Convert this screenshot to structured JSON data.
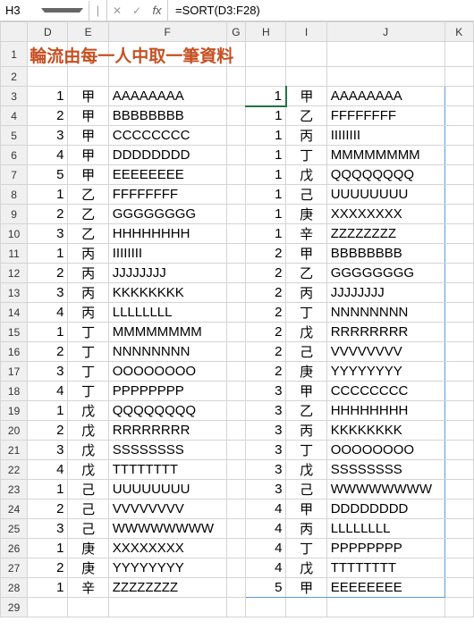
{
  "formula_bar": {
    "name_box": "H3",
    "cancel": "✕",
    "check": "✓",
    "fx": "fx",
    "formula": "=SORT(D3:F28)"
  },
  "columns": [
    "",
    "D",
    "E",
    "F",
    "G",
    "H",
    "I",
    "J",
    "K"
  ],
  "title": "輪流由每一人中取一筆資料",
  "chart_data": {
    "type": "table",
    "left_table": {
      "columns": [
        "D",
        "E",
        "F"
      ],
      "rows": [
        [
          1,
          "甲",
          "AAAAAAAA"
        ],
        [
          2,
          "甲",
          "BBBBBBBB"
        ],
        [
          3,
          "甲",
          "CCCCCCCC"
        ],
        [
          4,
          "甲",
          "DDDDDDDD"
        ],
        [
          5,
          "甲",
          "EEEEEEEE"
        ],
        [
          1,
          "乙",
          "FFFFFFFF"
        ],
        [
          2,
          "乙",
          "GGGGGGGG"
        ],
        [
          3,
          "乙",
          "HHHHHHHH"
        ],
        [
          1,
          "丙",
          "IIIIIIII"
        ],
        [
          2,
          "丙",
          "JJJJJJJJ"
        ],
        [
          3,
          "丙",
          "KKKKKKKK"
        ],
        [
          4,
          "丙",
          "LLLLLLLL"
        ],
        [
          1,
          "丁",
          "MMMMMMMM"
        ],
        [
          2,
          "丁",
          "NNNNNNNN"
        ],
        [
          3,
          "丁",
          "OOOOOOOO"
        ],
        [
          4,
          "丁",
          "PPPPPPPP"
        ],
        [
          1,
          "戊",
          "QQQQQQQQ"
        ],
        [
          2,
          "戊",
          "RRRRRRRR"
        ],
        [
          3,
          "戊",
          "SSSSSSSS"
        ],
        [
          4,
          "戊",
          "TTTTTTTT"
        ],
        [
          1,
          "己",
          "UUUUUUUU"
        ],
        [
          2,
          "己",
          "VVVVVVVV"
        ],
        [
          3,
          "己",
          "WWWWWWWW"
        ],
        [
          1,
          "庚",
          "XXXXXXXX"
        ],
        [
          2,
          "庚",
          "YYYYYYYY"
        ],
        [
          1,
          "辛",
          "ZZZZZZZZ"
        ]
      ]
    },
    "right_table": {
      "columns": [
        "H",
        "I",
        "J"
      ],
      "rows": [
        [
          1,
          "甲",
          "AAAAAAAA"
        ],
        [
          1,
          "乙",
          "FFFFFFFF"
        ],
        [
          1,
          "丙",
          "IIIIIIII"
        ],
        [
          1,
          "丁",
          "MMMMMMMM"
        ],
        [
          1,
          "戊",
          "QQQQQQQQ"
        ],
        [
          1,
          "己",
          "UUUUUUUU"
        ],
        [
          1,
          "庚",
          "XXXXXXXX"
        ],
        [
          1,
          "辛",
          "ZZZZZZZZ"
        ],
        [
          2,
          "甲",
          "BBBBBBBB"
        ],
        [
          2,
          "乙",
          "GGGGGGGG"
        ],
        [
          2,
          "丙",
          "JJJJJJJJ"
        ],
        [
          2,
          "丁",
          "NNNNNNNN"
        ],
        [
          2,
          "戊",
          "RRRRRRRR"
        ],
        [
          2,
          "己",
          "VVVVVVVV"
        ],
        [
          2,
          "庚",
          "YYYYYYYY"
        ],
        [
          3,
          "甲",
          "CCCCCCCC"
        ],
        [
          3,
          "乙",
          "HHHHHHHH"
        ],
        [
          3,
          "丙",
          "KKKKKKKK"
        ],
        [
          3,
          "丁",
          "OOOOOOOO"
        ],
        [
          3,
          "戊",
          "SSSSSSSS"
        ],
        [
          3,
          "己",
          "WWWWWWWW"
        ],
        [
          4,
          "甲",
          "DDDDDDDD"
        ],
        [
          4,
          "丙",
          "LLLLLLLL"
        ],
        [
          4,
          "丁",
          "PPPPPPPP"
        ],
        [
          4,
          "戊",
          "TTTTTTTT"
        ],
        [
          5,
          "甲",
          "EEEEEEEE"
        ]
      ]
    }
  },
  "row_start": 1,
  "row_end": 29,
  "active_cell": "H3"
}
